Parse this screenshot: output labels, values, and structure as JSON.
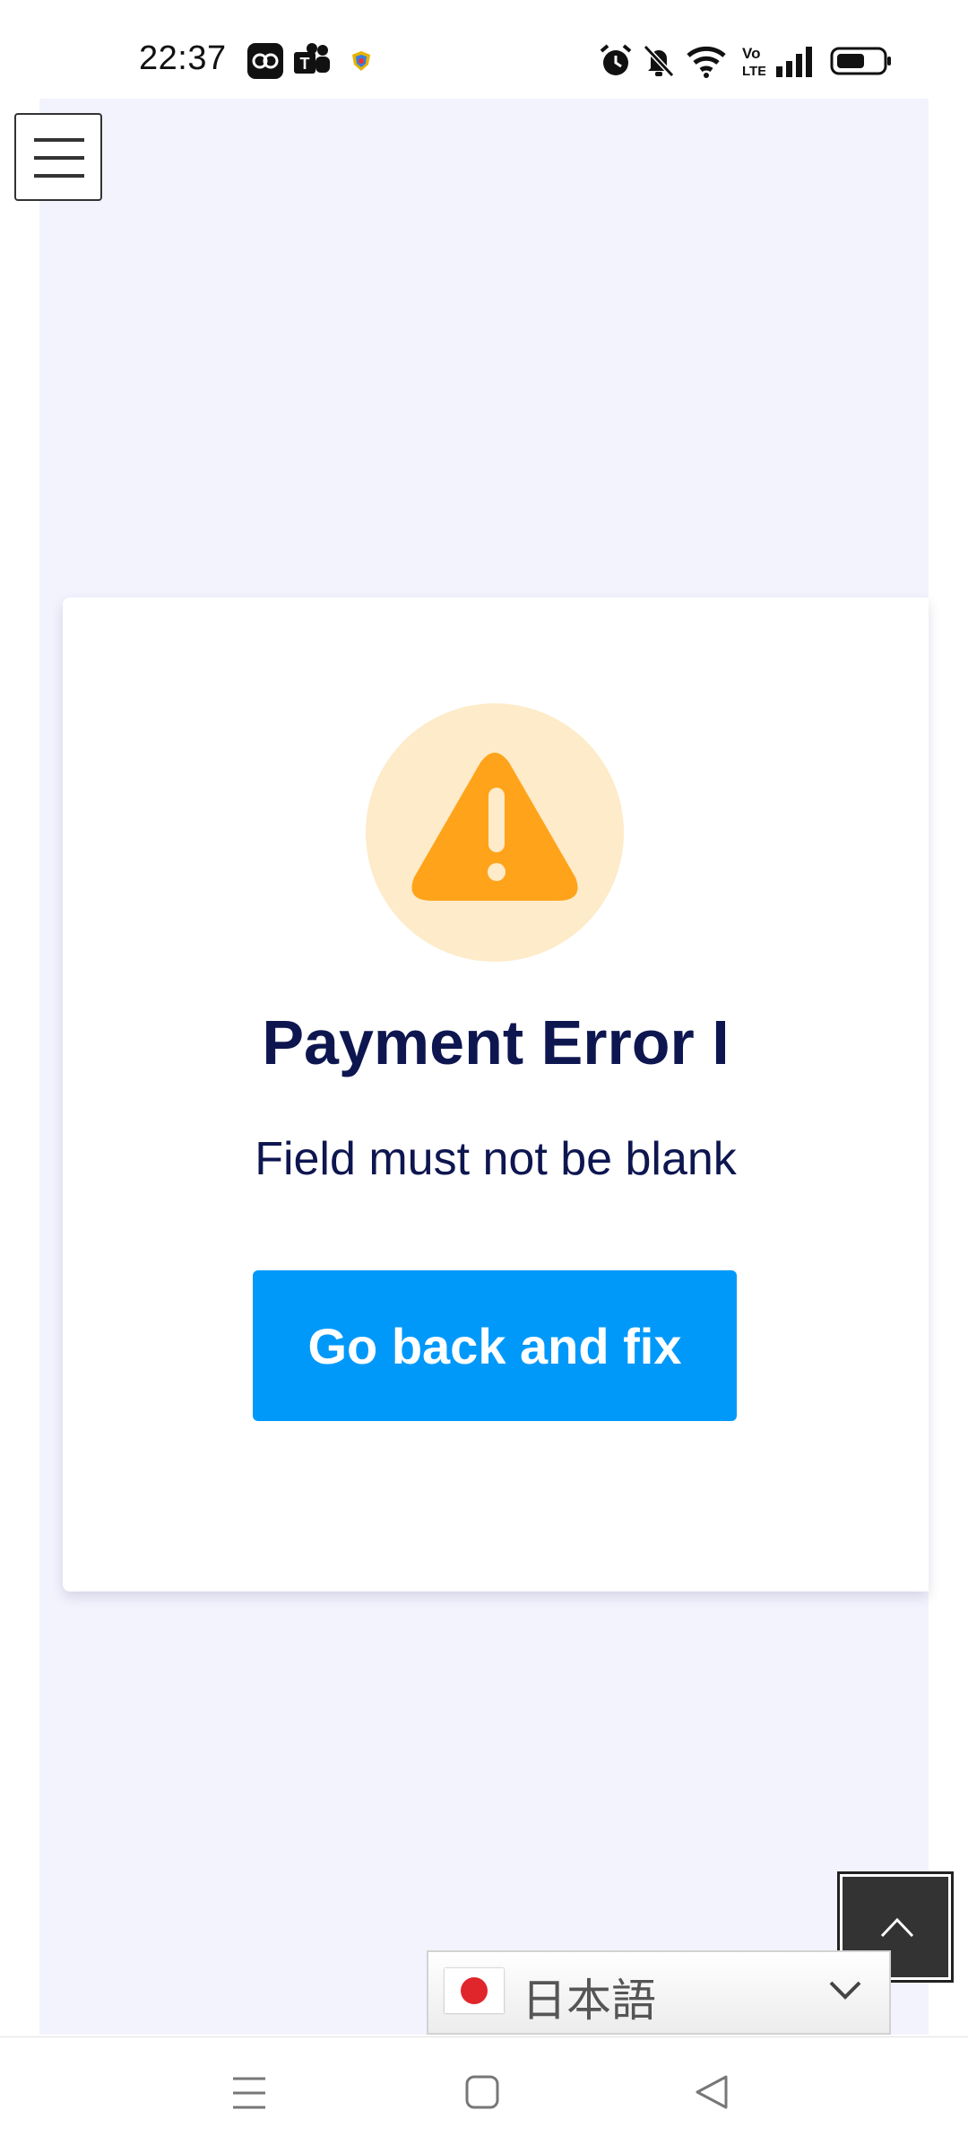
{
  "status_bar": {
    "time": "22:37",
    "left_icons": [
      "afterpay-icon",
      "teams-icon",
      "shield-app-icon"
    ],
    "right_icons": [
      "alarm-icon",
      "mute-icon",
      "wifi-icon",
      "volte-icon",
      "signal-icon",
      "battery-icon"
    ]
  },
  "menu": {
    "icon": "hamburger-menu-icon"
  },
  "error_card": {
    "icon": "warning-triangle-icon",
    "title": "Payment Error I",
    "message": "Field must not be blank",
    "button_label": "Go back and fix"
  },
  "language_selector": {
    "flag": "japan-flag",
    "label": "日本語"
  },
  "scroll_top": {
    "icon": "chevron-up-icon"
  },
  "nav_bar": {
    "buttons": [
      "menu-nav-icon",
      "home-nav-icon",
      "back-nav-icon"
    ]
  },
  "colors": {
    "accent_button": "#0099fa",
    "title_text": "#0e1650",
    "warning": "#ffa31a",
    "warning_bg": "#fdebc9",
    "page_bg": "#f3f3fe"
  }
}
